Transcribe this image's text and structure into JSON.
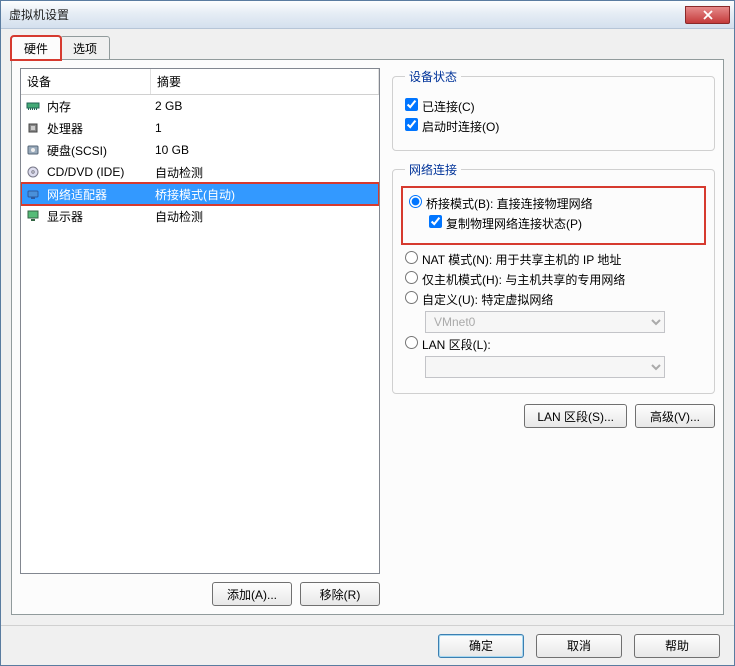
{
  "window": {
    "title": "虚拟机设置"
  },
  "tabs": {
    "hardware": "硬件",
    "options": "选项",
    "active": "hardware"
  },
  "device_list": {
    "header_device": "设备",
    "header_summary": "摘要",
    "rows": [
      {
        "icon": "memory-icon",
        "name": "内存",
        "summary": "2 GB",
        "selected": false
      },
      {
        "icon": "cpu-icon",
        "name": "处理器",
        "summary": "1",
        "selected": false
      },
      {
        "icon": "disk-icon",
        "name": "硬盘(SCSI)",
        "summary": "10 GB",
        "selected": false
      },
      {
        "icon": "cd-icon",
        "name": "CD/DVD (IDE)",
        "summary": "自动检测",
        "selected": false
      },
      {
        "icon": "network-icon",
        "name": "网络适配器",
        "summary": "桥接模式(自动)",
        "selected": true
      },
      {
        "icon": "display-icon",
        "name": "显示器",
        "summary": "自动检测",
        "selected": false
      }
    ]
  },
  "left_buttons": {
    "add": "添加(A)...",
    "remove": "移除(R)"
  },
  "device_status": {
    "legend": "设备状态",
    "connected": "已连接(C)",
    "connect_at_power_on": "启动时连接(O)"
  },
  "network_connection": {
    "legend": "网络连接",
    "bridged": "桥接模式(B): 直接连接物理网络",
    "replicate": "复制物理网络连接状态(P)",
    "nat": "NAT 模式(N): 用于共享主机的 IP 地址",
    "hostonly": "仅主机模式(H): 与主机共享的专用网络",
    "custom": "自定义(U): 特定虚拟网络",
    "vmnet_selected": "VMnet0",
    "lan_segment": "LAN 区段(L):",
    "lan_segment_selected": "",
    "buttons": {
      "lan_segments": "LAN 区段(S)...",
      "advanced": "高级(V)..."
    }
  },
  "footer": {
    "ok": "确定",
    "cancel": "取消",
    "help": "帮助"
  }
}
